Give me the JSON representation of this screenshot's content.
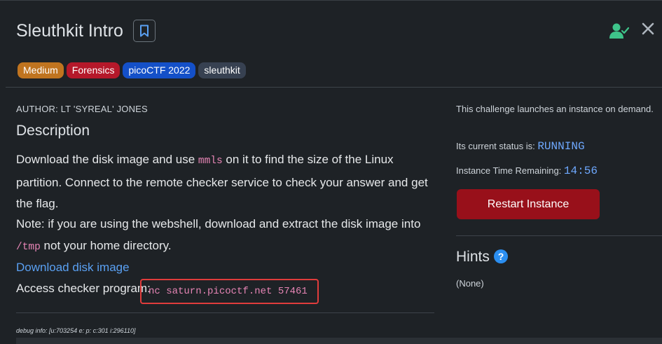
{
  "header": {
    "title": "Sleuthkit Intro",
    "tags": [
      {
        "label": "Medium",
        "color": "#c0741f"
      },
      {
        "label": "Forensics",
        "color": "#b5182a"
      },
      {
        "label": "picoCTF 2022",
        "color": "#1450c8"
      },
      {
        "label": "sleuthkit",
        "color": "#374151"
      }
    ]
  },
  "main": {
    "author": "AUTHOR: LT 'SYREAL' JONES",
    "description_title": "Description",
    "para1_pre": "Download the disk image and use ",
    "para1_code": "mmls",
    "para1_post": " on it to find the size of the Linux partition. Connect to the remote checker service to check your answer and get the flag.",
    "para2_pre": "Note: if you are using the webshell, download and extract the disk image into ",
    "para2_code": "/tmp",
    "para2_post": " not your home directory.",
    "download_link": "Download disk image",
    "checker_label": "Access checker program:",
    "checker_command": "nc saturn.picoctf.net 57461",
    "debug_info": "debug info: [u:703254 e: p: c:301 i:296110]"
  },
  "sidebar": {
    "launch_text": "This challenge launches an instance on demand.",
    "status_label": "Its current status is: ",
    "status_value": "RUNNING",
    "time_label": "Instance Time Remaining: ",
    "time_value": "14:56",
    "restart_button": "Restart Instance",
    "hints_title": "Hints",
    "hints_icon": "?",
    "hints_value": "(None)"
  },
  "colors": {
    "background": "#1e2226",
    "accent_link": "#5aa0f2",
    "restart_button": "#98101a",
    "status_value": "#6ea8fe",
    "code_text": "#e685b5",
    "highlight_box": "#e03c3c",
    "user_icon": "#3ec48a"
  },
  "icons": {
    "bookmark": "bookmark-icon",
    "user_check": "user-check-icon",
    "close": "close-icon",
    "help": "question-circle-icon"
  }
}
